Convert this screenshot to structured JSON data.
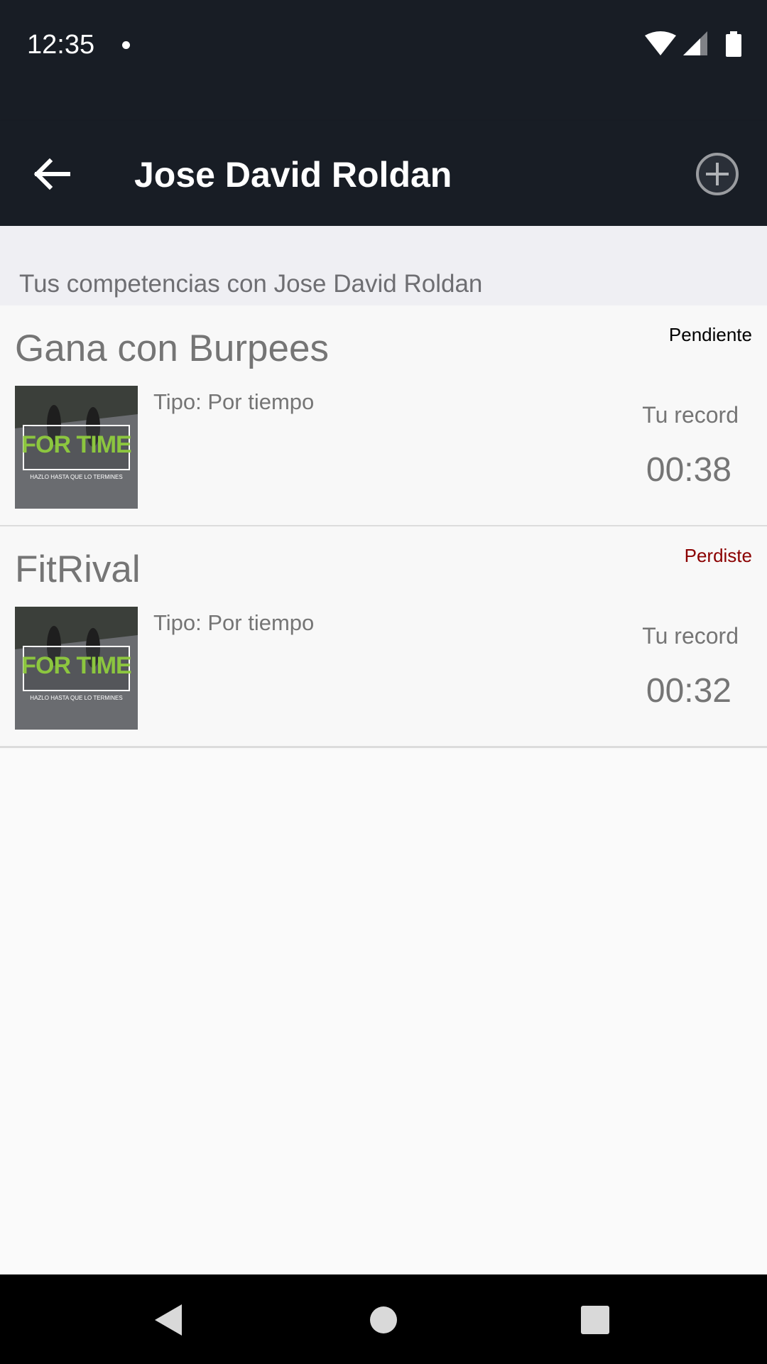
{
  "status_bar": {
    "time": "12:35"
  },
  "app_bar": {
    "title": "Jose David Roldan",
    "back_icon": "arrow-back-icon",
    "add_icon": "add-circle-icon"
  },
  "section": {
    "header": "Tus competencias con Jose David Roldan"
  },
  "competitions": [
    {
      "title": "Gana con Burpees",
      "status": "Pendiente",
      "status_color": "#000000",
      "thumbnail": {
        "headline": "FOR TIME",
        "caption": "HAZLO HASTA QUE LO TERMINES"
      },
      "type": "Tipo: Por tiempo",
      "record_label": "Tu record",
      "record_value": "00:38"
    },
    {
      "title": "FitRival",
      "status": "Perdiste",
      "status_color": "#8b0000",
      "thumbnail": {
        "headline": "FOR TIME",
        "caption": "HAZLO HASTA QUE LO TERMINES"
      },
      "type": "Tipo: Por tiempo",
      "record_label": "Tu record",
      "record_value": "00:32"
    }
  ],
  "colors": {
    "bar_background": "#181d25",
    "thumbnail_headline": "#8cc63f"
  }
}
